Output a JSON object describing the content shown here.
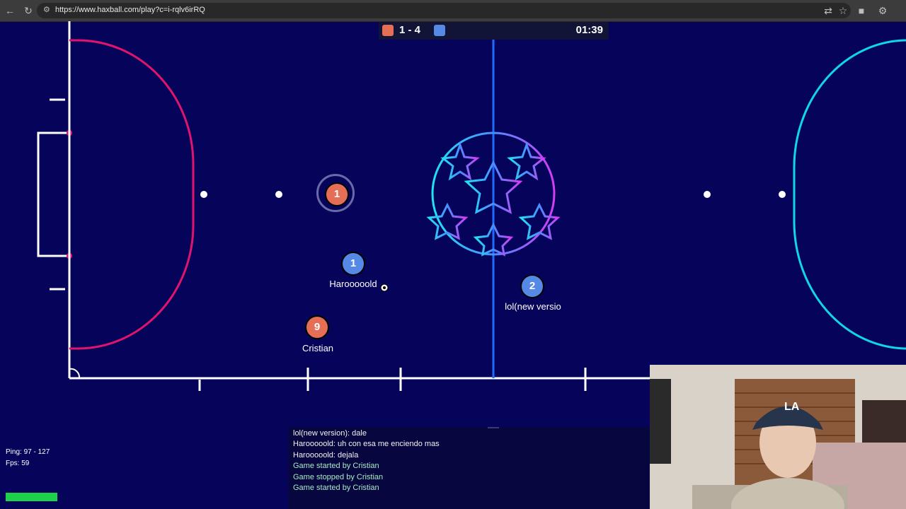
{
  "browser": {
    "url": "https://www.haxball.com/play?c=i-rqlv6irRQ",
    "nav_icons": [
      "back-arrow-icon",
      "reload-icon"
    ],
    "toolbar_icons": [
      "translate-icon",
      "star-icon",
      "extensions-icon",
      "settings-icon"
    ]
  },
  "scoreboard": {
    "score": "1 - 4",
    "time": "01:39",
    "red_color": "#e56e56",
    "blue_color": "#5689e5"
  },
  "players": [
    {
      "number": "1",
      "name": "",
      "team": "red"
    },
    {
      "number": "1",
      "name": "Harooooold",
      "team": "blue"
    },
    {
      "number": "2",
      "name": "lol(new versio",
      "team": "blue"
    },
    {
      "number": "9",
      "name": "Cristian",
      "team": "red"
    }
  ],
  "stats": {
    "ping": "Ping: 97 - 127",
    "fps": "Fps: 59"
  },
  "chat": [
    {
      "text": "lol(new version): dale",
      "type": "message"
    },
    {
      "text": "Harooooold: uh con esa me enciendo mas",
      "type": "message"
    },
    {
      "text": "Harooooold: dejala",
      "type": "message"
    },
    {
      "text": "Game started by Cristian",
      "type": "notice"
    },
    {
      "text": "Game stopped by Cristian",
      "type": "notice"
    },
    {
      "text": "Game started by Cristian",
      "type": "notice"
    }
  ],
  "colors": {
    "pitch": "#06045a",
    "left_arc": "#e0146f",
    "right_arc": "#10d6ec",
    "center_line": "#1e6cff"
  }
}
